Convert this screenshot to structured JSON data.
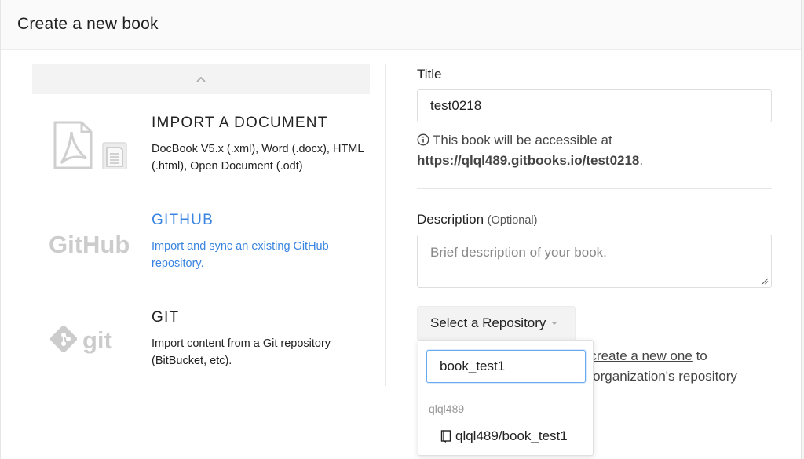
{
  "modal": {
    "title": "Create a new book"
  },
  "sources": [
    {
      "title": "IMPORT A DOCUMENT",
      "description": "DocBook V5.x (.xml), Word (.docx), HTML (.html), Open Document (.odt)",
      "logo": "pdf-and-document-icon"
    },
    {
      "title": "GITHUB",
      "description": "Import and sync an existing GitHub repository.",
      "logo": "GitHub"
    },
    {
      "title": "GIT",
      "description": "Import content from a Git repository (BitBucket, etc).",
      "logo": "git"
    }
  ],
  "form": {
    "title_label": "Title",
    "title_value": "test0218",
    "hint_prefix": "This book will be accessible at",
    "hint_url": "https://qlql489.gitbooks.io/test0218",
    "hint_suffix": ".",
    "description_label": "Description",
    "description_optional": "(Optional)",
    "description_placeholder": "Brief description of your book.",
    "repo_button_label": "Select a Repository",
    "behind_text_line1_suffix": "to",
    "behind_link": "create a new one",
    "behind_text_line2": "b organization's repository",
    "behind_text_line1_prefix": "r"
  },
  "dropdown": {
    "search_value": "book_test1",
    "group_label": "qlql489",
    "items": [
      {
        "label": "qlql489/book_test1",
        "icon": "book-icon"
      }
    ]
  },
  "colors": {
    "accent": "#3884e0",
    "focus_border": "#6aaaf0"
  }
}
